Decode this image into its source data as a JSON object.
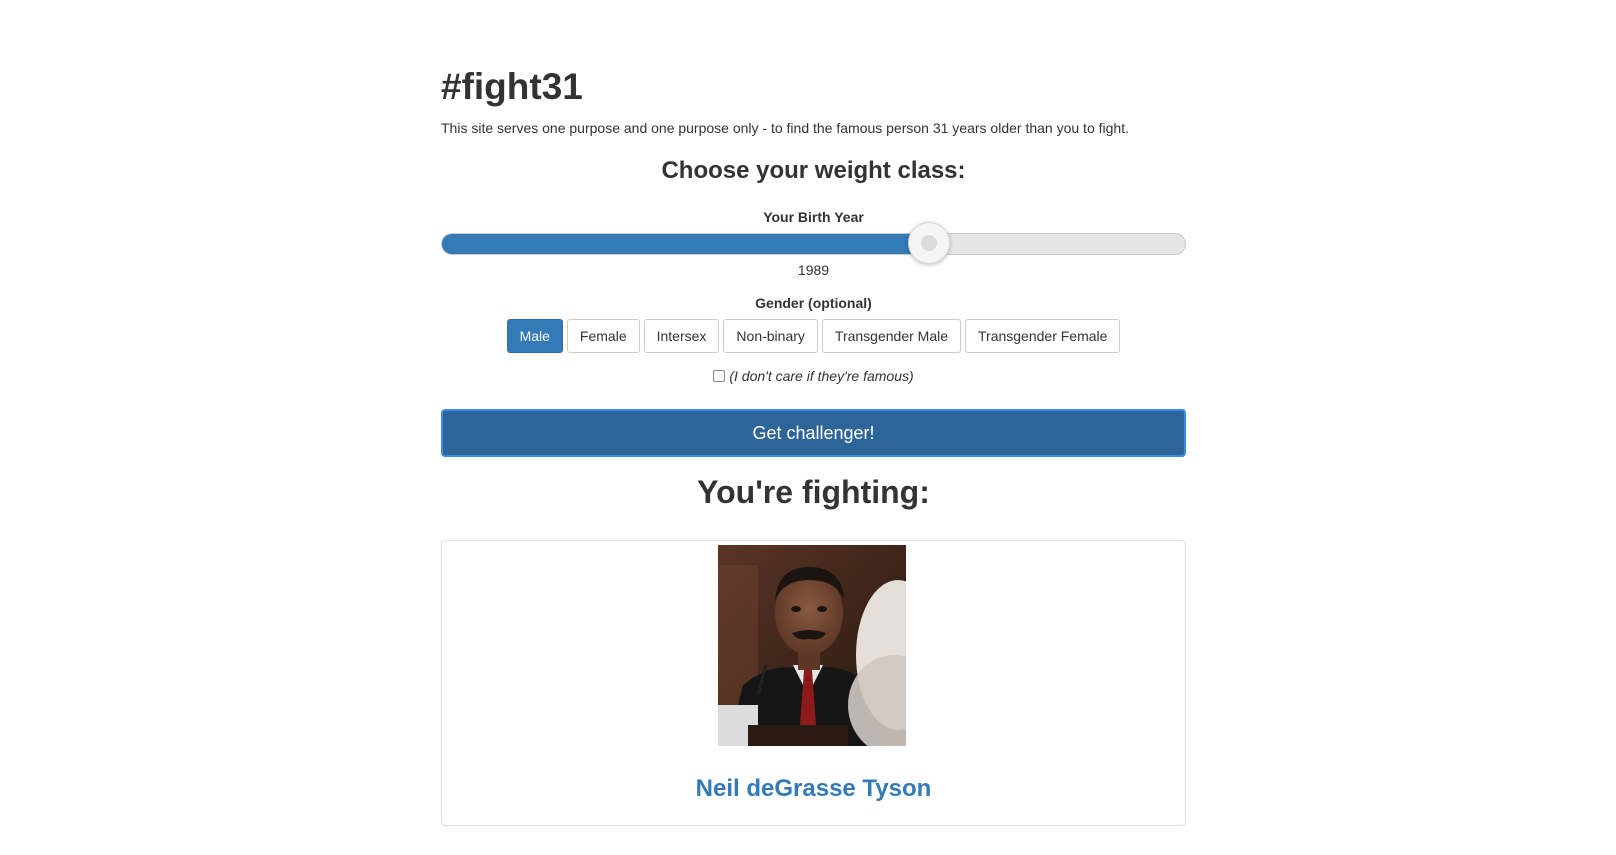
{
  "header": {
    "title": "#fight31",
    "tagline": "This site serves one purpose and one purpose only - to find the famous person 31 years older than you to fight."
  },
  "weight_class": {
    "heading": "Choose your weight class:",
    "slider_label": "Your Birth Year",
    "birth_year": "1989",
    "slider_fraction": 0.655
  },
  "gender": {
    "label": "Gender (optional)",
    "options": [
      "Male",
      "Female",
      "Intersex",
      "Non-binary",
      "Transgender Male",
      "Transgender Female"
    ],
    "selected": "Male"
  },
  "famous_toggle": {
    "label": "(I don't care if they're famous)",
    "checked": false
  },
  "cta_label": "Get challenger!",
  "result": {
    "heading": "You're fighting:",
    "name": "Neil deGrasse Tyson"
  },
  "colors": {
    "accent": "#337ab7",
    "cta_bg": "#2d6598",
    "cta_border": "#3b8ee8"
  }
}
